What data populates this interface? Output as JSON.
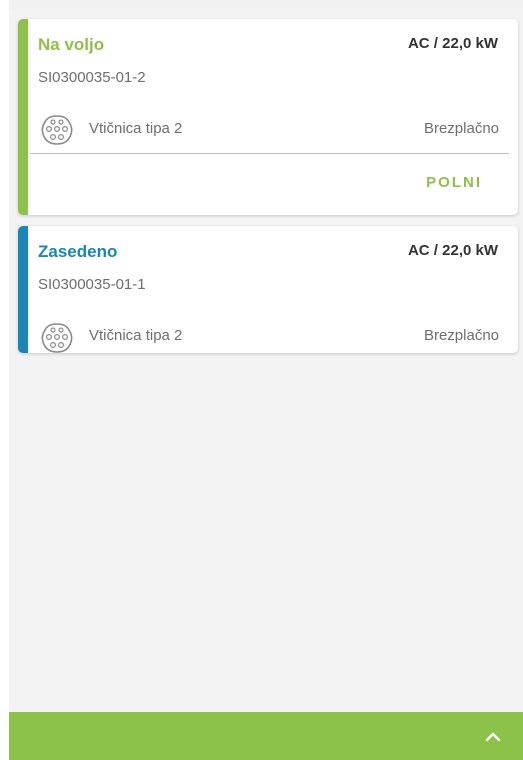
{
  "colors": {
    "available": "#8dc24a",
    "occupied": "#1a86b5",
    "bottom_bar": "#8dc24a"
  },
  "connectors": [
    {
      "status": "Na voljo",
      "power": "AC / 22,0 kW",
      "id": "SI0300035-01-2",
      "plug_type": "Vtičnica tipa 2",
      "price": "Brezplačno",
      "action_label": "POLNI",
      "icon": "type2-plug-icon"
    },
    {
      "status": "Zasedeno",
      "power": "AC / 22,0 kW",
      "id": "SI0300035-01-1",
      "plug_type": "Vtičnica tipa 2",
      "price": "Brezplačno",
      "icon": "type2-plug-icon"
    }
  ],
  "bottom_bar": {
    "icon": "chevron-up-icon"
  }
}
